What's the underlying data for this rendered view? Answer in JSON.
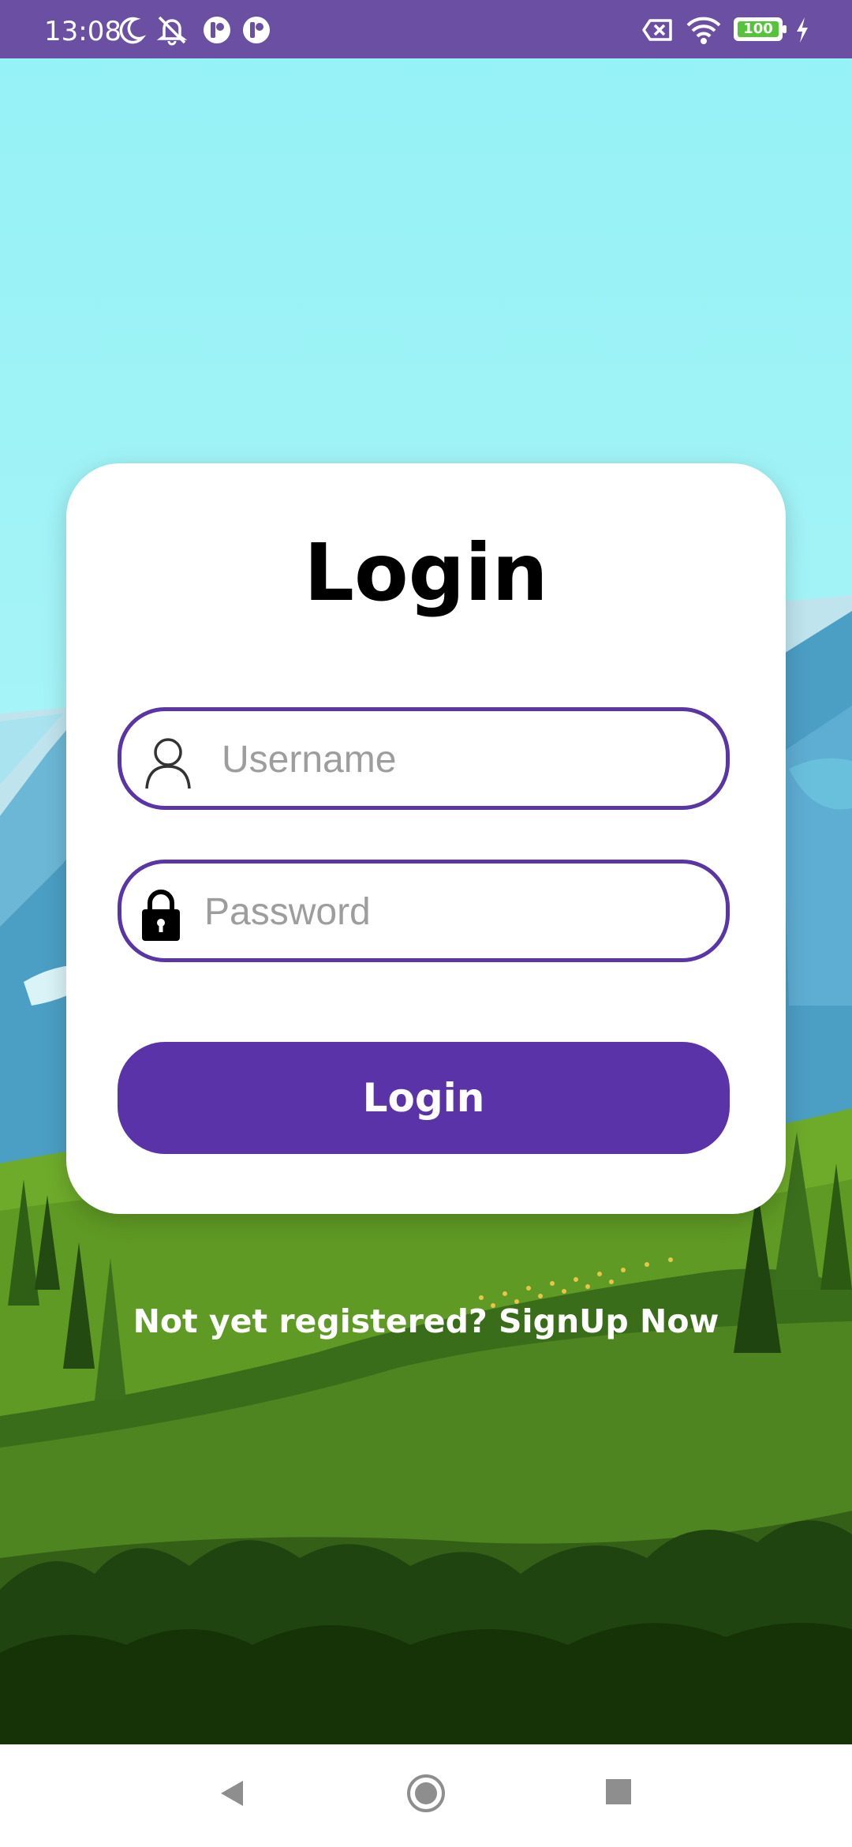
{
  "status_bar": {
    "time": "13:08",
    "battery_level": "100",
    "icons": [
      "moon-icon",
      "notifications-off-icon",
      "app-notification-icon",
      "app-notification-icon",
      "sim-card-off-icon",
      "wifi-icon",
      "battery-icon",
      "charging-icon"
    ],
    "background_color": "#6a4fa2"
  },
  "login_card": {
    "title": "Login",
    "username": {
      "placeholder": "Username",
      "value": "",
      "icon": "user-icon"
    },
    "password": {
      "placeholder": "Password",
      "value": "",
      "icon": "lock-icon"
    },
    "login_button_label": "Login",
    "accent_color": "#5a33a8"
  },
  "signup_link": "Not yet registered? SignUp Now",
  "nav_bar": {
    "buttons": [
      "back-icon",
      "home-icon",
      "recents-icon"
    ]
  }
}
